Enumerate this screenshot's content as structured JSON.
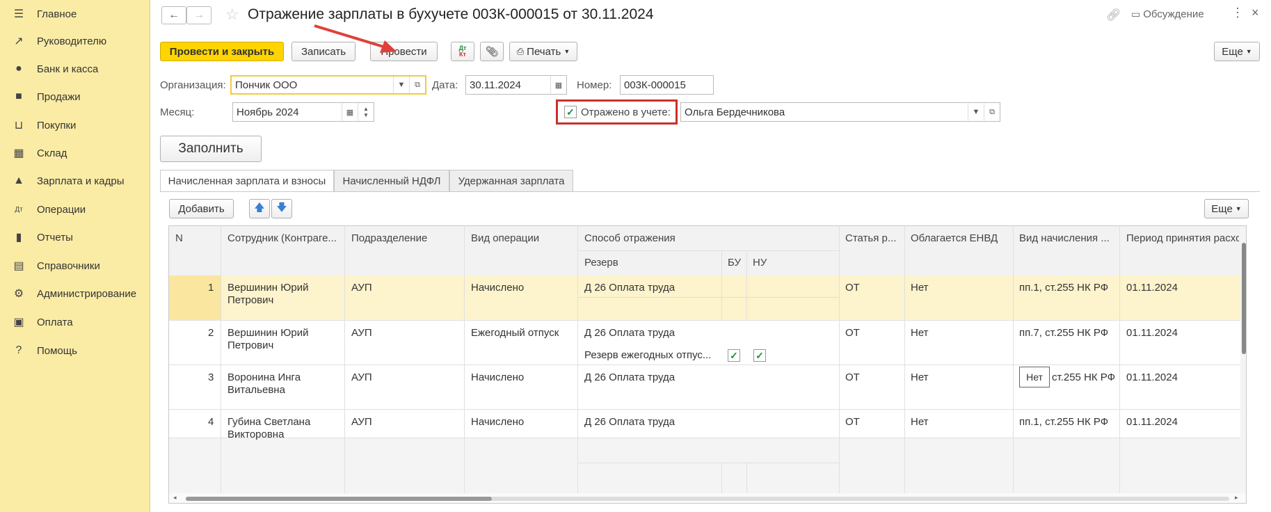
{
  "sidebar": {
    "items": [
      {
        "label": "Главное",
        "icon": "menu-icon"
      },
      {
        "label": "Руководителю",
        "icon": "trend-icon"
      },
      {
        "label": "Банк и касса",
        "icon": "coin-icon"
      },
      {
        "label": "Продажи",
        "icon": "bag-icon"
      },
      {
        "label": "Покупки",
        "icon": "cart-icon"
      },
      {
        "label": "Склад",
        "icon": "warehouse-icon"
      },
      {
        "label": "Зарплата и кадры",
        "icon": "person-icon"
      },
      {
        "label": "Операции",
        "icon": "dt-kt-icon"
      },
      {
        "label": "Отчеты",
        "icon": "bar-chart-icon"
      },
      {
        "label": "Справочники",
        "icon": "books-icon"
      },
      {
        "label": "Администрирование",
        "icon": "gear-icon"
      },
      {
        "label": "Оплата",
        "icon": "wallet-icon"
      },
      {
        "label": "Помощь",
        "icon": "question-icon"
      }
    ]
  },
  "header": {
    "title": "Отражение зарплаты в бухучете 003К-000015 от 30.11.2024",
    "discussion": "Обсуждение"
  },
  "toolbar": {
    "post_close": "Провести и закрыть",
    "save": "Записать",
    "post": "Провести",
    "dtkt_top": "Дт",
    "dtkt_bottom": "Кт",
    "print": "Печать",
    "more": "Еще"
  },
  "form": {
    "org_label": "Организация:",
    "org_value": "Пончик ООО",
    "date_label": "Дата:",
    "date_value": "30.11.2024",
    "number_label": "Номер:",
    "number_value": "003К-000015",
    "month_label": "Месяц:",
    "month_value": "Ноябрь 2024",
    "reflected_label": "Отражено в учете:",
    "reflected_user": "Ольга Бердечникова",
    "fill_button": "Заполнить"
  },
  "tabs": [
    {
      "label": "Начисленная зарплата и взносы",
      "active": true
    },
    {
      "label": "Начисленный НДФЛ",
      "active": false
    },
    {
      "label": "Удержанная зарплата",
      "active": false
    }
  ],
  "table_toolbar": {
    "add": "Добавить",
    "more": "Еще"
  },
  "table": {
    "headers": {
      "n": "N",
      "employee": "Сотрудник (Контраге...",
      "department": "Подразделение",
      "operation": "Вид операции",
      "method": "Способ отражения",
      "reserve": "Резерв",
      "bu": "БУ",
      "nu": "НУ",
      "article": "Статья р...",
      "envd": "Облагается ЕНВД",
      "accrual_type": "Вид начисления ...",
      "period": "Период принятия расходов"
    },
    "rows": [
      {
        "n": "1",
        "employee_1": "Вершинин Юрий",
        "employee_2": "Петрович",
        "department": "АУП",
        "operation": "Начислено",
        "method": "Д 26 Оплата труда",
        "reserve": "",
        "article": "ОТ",
        "envd": "Нет",
        "accrual": "пп.1, ст.255 НК РФ",
        "period": "01.11.2024"
      },
      {
        "n": "2",
        "employee_1": "Вершинин Юрий",
        "employee_2": "Петрович",
        "department": "АУП",
        "operation": "Ежегодный отпуск",
        "method": "Д 26 Оплата труда",
        "reserve": "Резерв ежегодных отпус...",
        "bu_checked": true,
        "nu_checked": true,
        "article": "ОТ",
        "envd": "Нет",
        "accrual": "пп.7, ст.255 НК РФ",
        "period": "01.11.2024"
      },
      {
        "n": "3",
        "employee_1": "Воронина Инга",
        "employee_2": "Витальевна",
        "department": "АУП",
        "operation": "Начислено",
        "method": "Д 26 Оплата труда",
        "reserve": "",
        "article": "ОТ",
        "envd": "Нет",
        "accrual": "ст.255 НК РФ",
        "accrual_tooltip": "Нет",
        "period": "01.11.2024"
      },
      {
        "n": "4",
        "employee_1": "Губина Светлана",
        "employee_2": "Викторовна",
        "department": "АУП",
        "operation": "Начислено",
        "method": "Д 26 Оплата труда",
        "reserve": "",
        "article": "ОТ",
        "envd": "Нет",
        "accrual": "пп.1, ст.255 НК РФ",
        "period": "01.11.2024"
      }
    ]
  },
  "colors": {
    "sidebar_bg": "#fbeca5",
    "primary_button": "#ffd400",
    "selected_row": "#fdf3cc",
    "highlight_frame": "#c9302c",
    "annotation_arrow": "#e0403a"
  }
}
